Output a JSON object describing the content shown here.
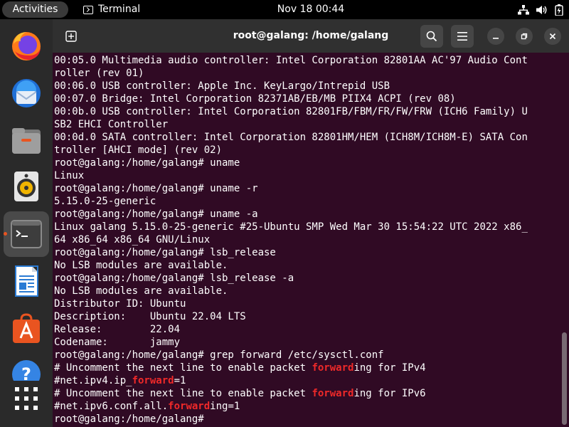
{
  "topbar": {
    "activities": "Activities",
    "app_name": "Terminal",
    "clock": "Nov 18  00:44",
    "icons": [
      "network-icon",
      "volume-icon",
      "battery-icon"
    ]
  },
  "dock": {
    "items": [
      "firefox-icon",
      "thunderbird-icon",
      "files-icon",
      "rhythmbox-icon",
      "terminal-icon",
      "libreoffice-writer-icon",
      "app-center-icon",
      "help-icon",
      "show-apps-icon"
    ],
    "active": "terminal-icon",
    "accent": "#e95420"
  },
  "window": {
    "title": "root@galang: /home/galang",
    "background": "#300a24",
    "highlight_color": "#ef2929"
  },
  "terminal": {
    "lines": [
      [
        {
          "t": "00:05.0 Multimedia audio controller: Intel Corporation 82801AA AC'97 Audio Cont"
        }
      ],
      [
        {
          "t": "roller (rev 01)"
        }
      ],
      [
        {
          "t": "00:06.0 USB controller: Apple Inc. KeyLargo/Intrepid USB"
        }
      ],
      [
        {
          "t": "00:07.0 Bridge: Intel Corporation 82371AB/EB/MB PIIX4 ACPI (rev 08)"
        }
      ],
      [
        {
          "t": "00:0b.0 USB controller: Intel Corporation 82801FB/FBM/FR/FW/FRW (ICH6 Family) U"
        }
      ],
      [
        {
          "t": "SB2 EHCI Controller"
        }
      ],
      [
        {
          "t": "00:0d.0 SATA controller: Intel Corporation 82801HM/HEM (ICH8M/ICH8M-E) SATA Con"
        }
      ],
      [
        {
          "t": "troller [AHCI mode] (rev 02)"
        }
      ],
      [
        {
          "t": "root@galang:/home/galang# uname"
        }
      ],
      [
        {
          "t": "Linux"
        }
      ],
      [
        {
          "t": "root@galang:/home/galang# uname -r"
        }
      ],
      [
        {
          "t": "5.15.0-25-generic"
        }
      ],
      [
        {
          "t": "root@galang:/home/galang# uname -a"
        }
      ],
      [
        {
          "t": "Linux galang 5.15.0-25-generic #25-Ubuntu SMP Wed Mar 30 15:54:22 UTC 2022 x86_"
        }
      ],
      [
        {
          "t": "64 x86_64 x86_64 GNU/Linux"
        }
      ],
      [
        {
          "t": "root@galang:/home/galang# lsb_release"
        }
      ],
      [
        {
          "t": "No LSB modules are available."
        }
      ],
      [
        {
          "t": "root@galang:/home/galang# lsb_release -a"
        }
      ],
      [
        {
          "t": "No LSB modules are available."
        }
      ],
      [
        {
          "t": "Distributor ID: Ubuntu"
        }
      ],
      [
        {
          "t": "Description:    Ubuntu 22.04 LTS"
        }
      ],
      [
        {
          "t": "Release:        22.04"
        }
      ],
      [
        {
          "t": "Codename:       jammy"
        }
      ],
      [
        {
          "t": "root@galang:/home/galang# grep forward /etc/sysctl.conf"
        }
      ],
      [
        {
          "t": "# Uncomment the next line to enable packet "
        },
        {
          "t": "forward",
          "hl": true
        },
        {
          "t": "ing for IPv4"
        }
      ],
      [
        {
          "t": "#net.ipv4.ip_"
        },
        {
          "t": "forward",
          "hl": true
        },
        {
          "t": "=1"
        }
      ],
      [
        {
          "t": "# Uncomment the next line to enable packet "
        },
        {
          "t": "forward",
          "hl": true
        },
        {
          "t": "ing for IPv6"
        }
      ],
      [
        {
          "t": "#net.ipv6.conf.all."
        },
        {
          "t": "forward",
          "hl": true
        },
        {
          "t": "ing=1"
        }
      ],
      [
        {
          "t": "root@galang:/home/galang# "
        }
      ]
    ]
  }
}
